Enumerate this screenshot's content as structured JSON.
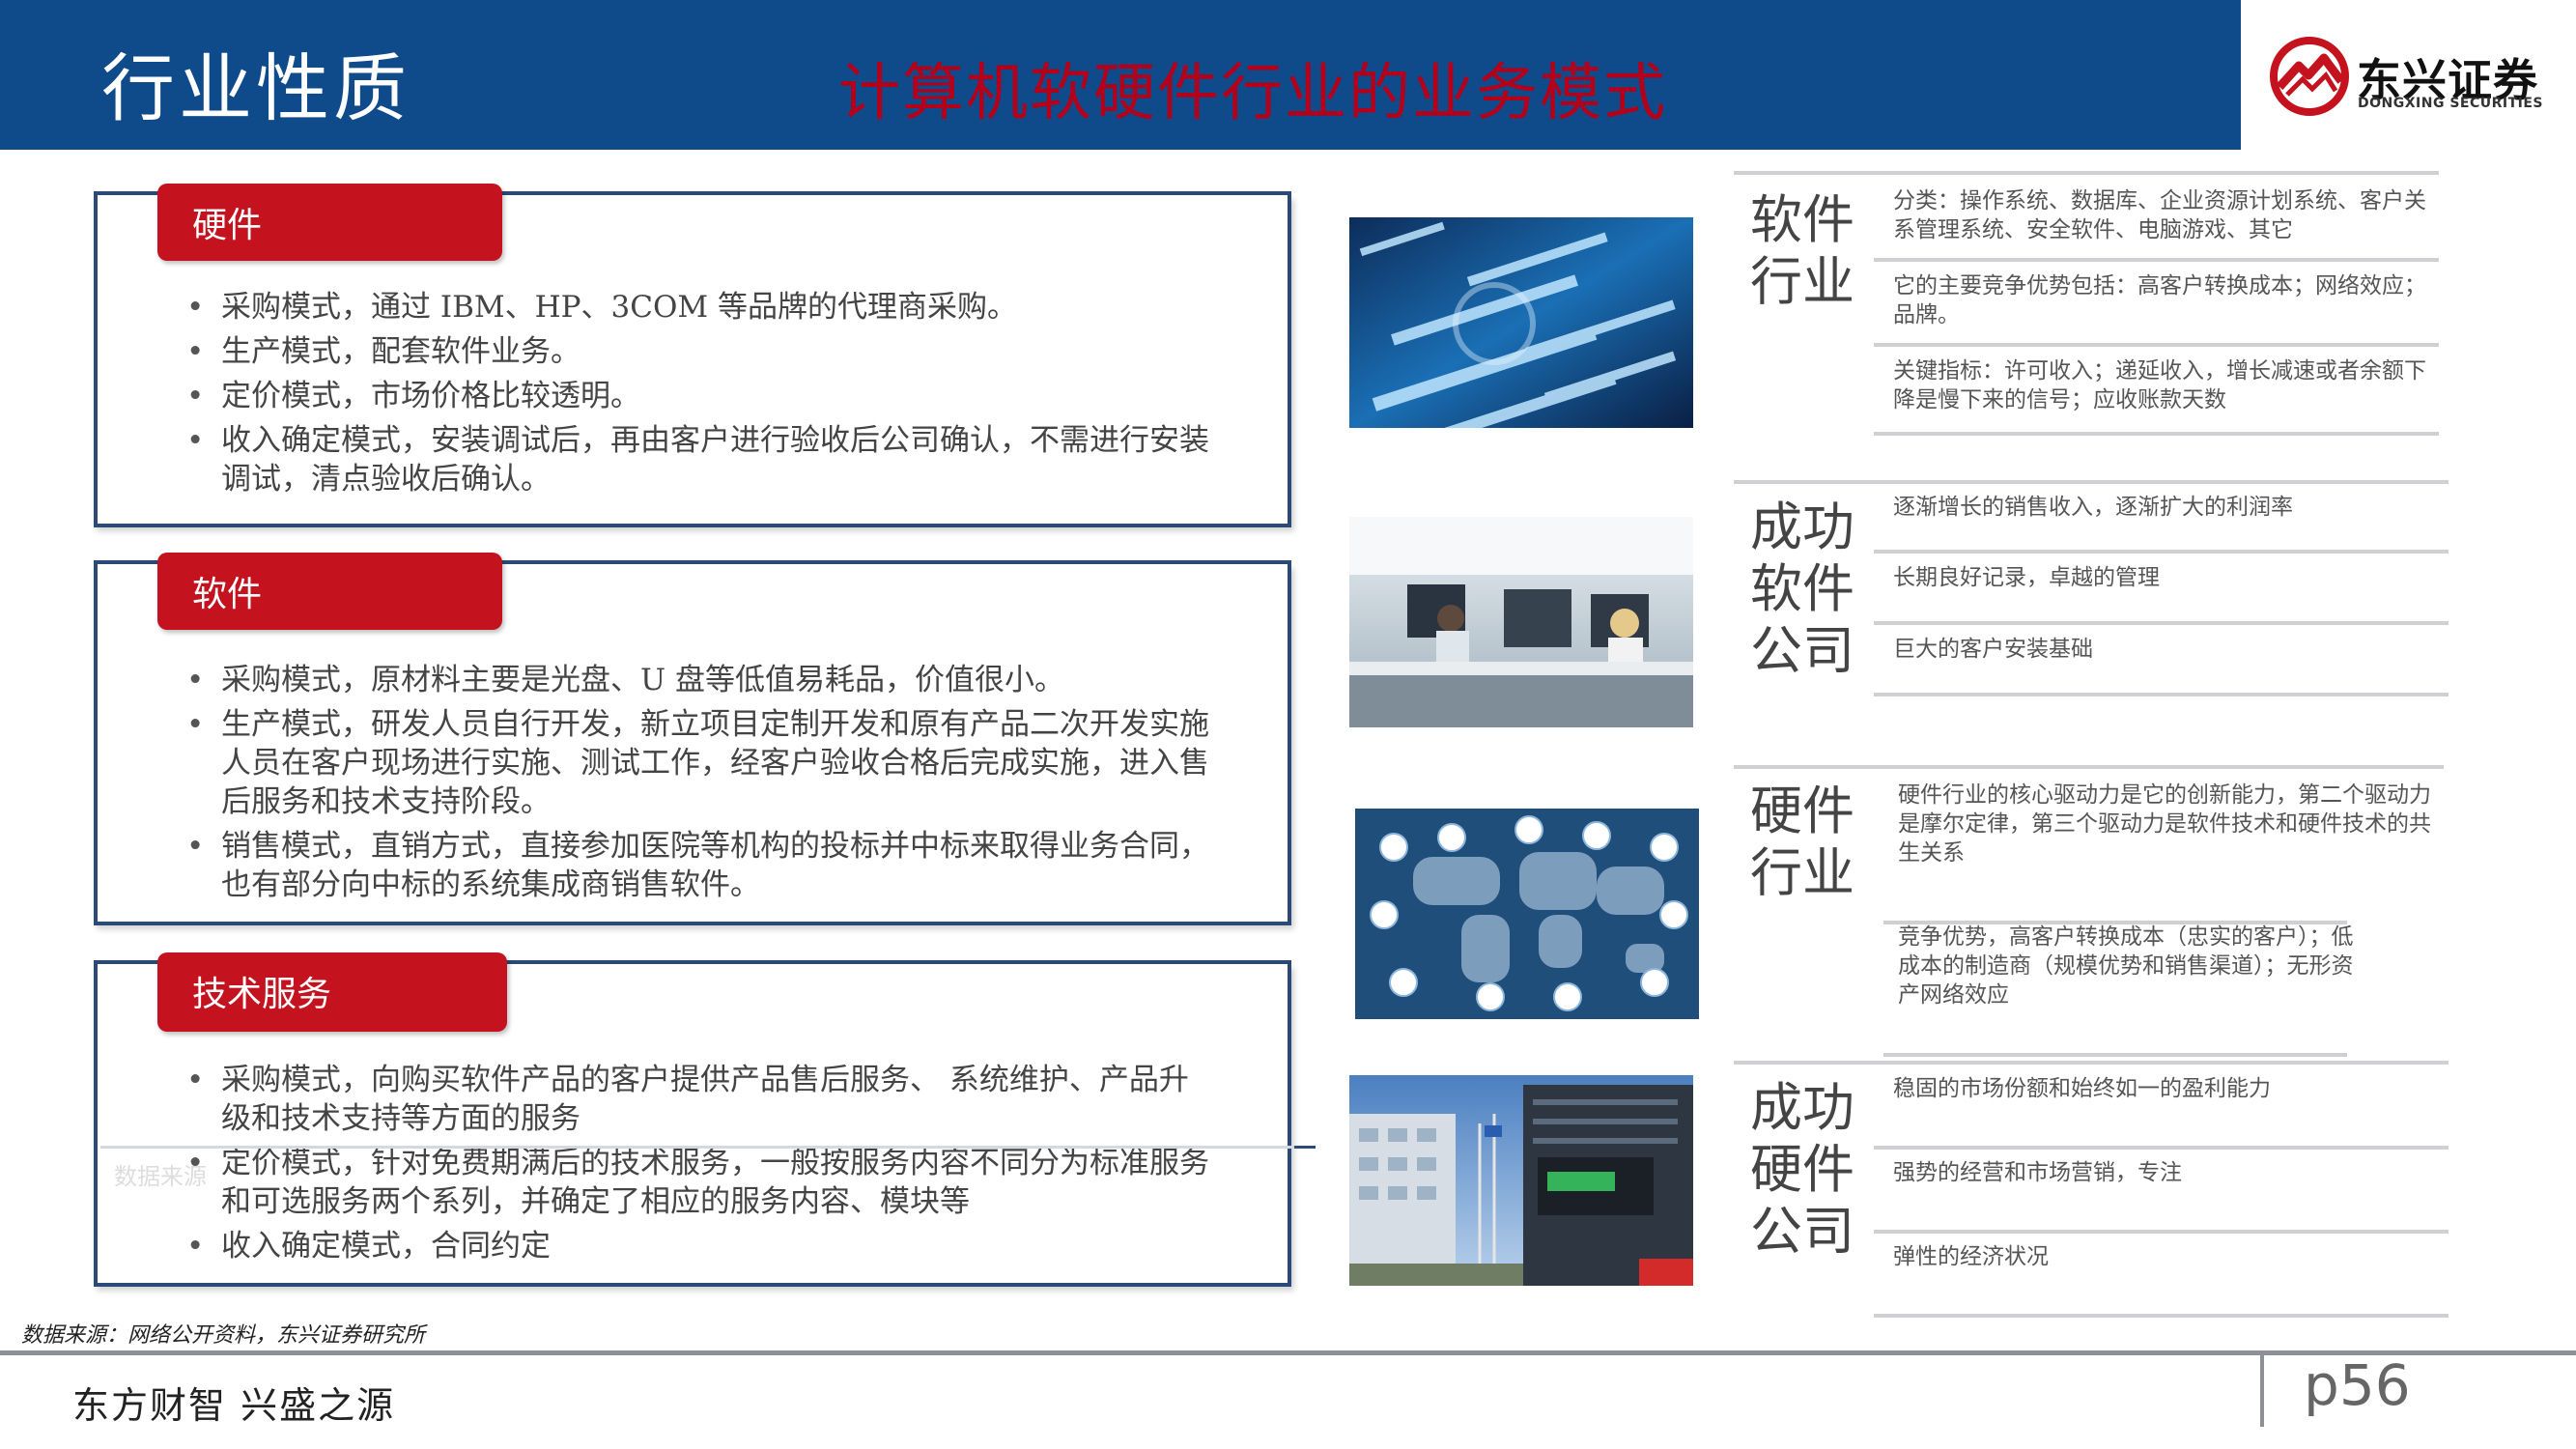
{
  "header": {
    "title": "行业性质",
    "subtitle": "计算机软硬件行业的业务模式"
  },
  "logo": {
    "name_cn": "东兴证券",
    "name_en": "DONGXING SECURITIES",
    "brand_color": "#c4121e"
  },
  "sections": [
    {
      "tab": "硬件",
      "bullets": [
        "采购模式，通过 IBM、HP、3COM 等品牌的代理商采购。",
        "生产模式，配套软件业务。",
        "定价模式，市场价格比较透明。",
        "收入确定模式，安装调试后，再由客户进行验收后公司确认，不需进行安装调试，清点验收后确认。"
      ]
    },
    {
      "tab": "软件",
      "bullets": [
        "采购模式，原材料主要是光盘、U 盘等低值易耗品，价值很小。",
        "生产模式，研发人员自行开发，新立项目定制开发和原有产品二次开发实施人员在客户现场进行实施、测试工作，经客户验收合格后完成实施，进入售后服务和技术支持阶段。",
        "销售模式，直销方式，直接参加医院等机构的投标并中标来取得业务合同，  也有部分向中标的系统集成商销售软件。"
      ]
    },
    {
      "tab": "技术服务",
      "bullets": [
        "采购模式，向购买软件产品的客户提供产品售后服务、 系统维护、产品升级和技术支持等方面的服务",
        "定价模式，针对免费期满后的技术服务，一般按服务内容不同分为标准服务和可选服务两个系列，并确定了相应的服务内容、模块等",
        "收入确定模式，合同约定"
      ]
    }
  ],
  "ghost_text": "数据来源",
  "right_groups": [
    {
      "heading": "软件\n行业",
      "items": [
        "分类：操作系统、数据库、企业资源计划系统、客户关系管理系统、安全软件、电脑游戏、其它",
        "它的主要竞争优势包括：高客户转换成本；网络效应；品牌。",
        "关键指标：许可收入；递延收入，增长减速或者余额下降是慢下来的信号；应收账款天数"
      ]
    },
    {
      "heading": "成功\n软件\n公司",
      "items": [
        "逐渐增长的销售收入，逐渐扩大的利润率",
        "长期良好记录，卓越的管理",
        "巨大的客户安装基础"
      ]
    },
    {
      "heading": "硬件\n行业",
      "items": [
        "硬件行业的核心驱动力是它的创新能力，第二个驱动力是摩尔定律，第三个驱动力是软件技术和硬件技术的共生关系",
        "竞争优势，高客户转换成本（忠实的客户）；低成本的制造商（规模优势和销售渠道）；无形资产网络效应"
      ]
    },
    {
      "heading": "成功\n硬件\n公司",
      "items": [
        "稳固的市场份额和始终如一的盈利能力",
        "强势的经营和市场营销，专注",
        "弹性的经济状况"
      ]
    }
  ],
  "footer": {
    "source": "数据来源：网络公开资料，东兴证券研究所",
    "slogan": "东方财智 兴盛之源",
    "page": "p56"
  }
}
